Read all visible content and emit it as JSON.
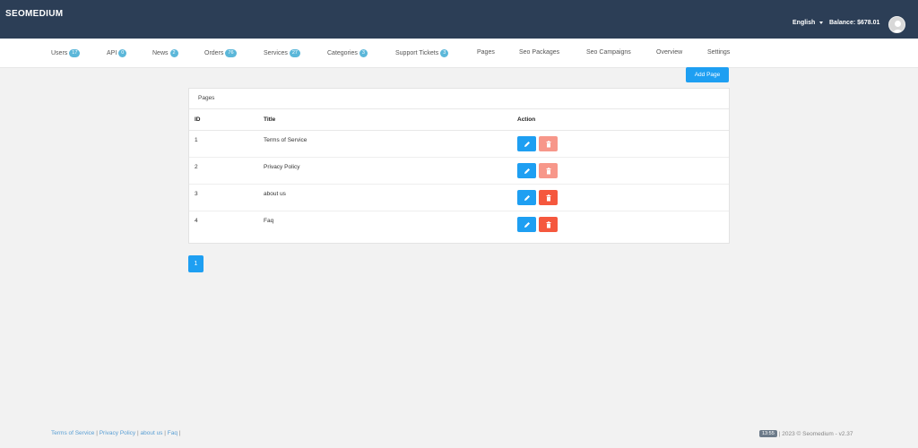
{
  "header": {
    "brand": "SEOMEDIUM",
    "language": "English",
    "balance": "Balance: $678.01"
  },
  "nav": [
    {
      "label": "Users",
      "badge": "17"
    },
    {
      "label": "API",
      "badge": "0"
    },
    {
      "label": "News",
      "badge": "2"
    },
    {
      "label": "Orders",
      "badge": "76"
    },
    {
      "label": "Services",
      "badge": "27"
    },
    {
      "label": "Categories",
      "badge": "3"
    },
    {
      "label": "Support Tickets",
      "badge": "3"
    },
    {
      "label": "Pages"
    },
    {
      "label": "Seo Packages"
    },
    {
      "label": "Seo Campaigns"
    },
    {
      "label": "Overview"
    },
    {
      "label": "Settings"
    }
  ],
  "add_page_label": "Add Page",
  "panel": {
    "title": "Pages",
    "columns": {
      "id": "ID",
      "title": "Title",
      "action": "Action"
    },
    "rows": [
      {
        "id": "1",
        "title": "Terms of Service",
        "delete_color": "#f7978a"
      },
      {
        "id": "2",
        "title": "Privacy Policy",
        "delete_color": "#f7978a"
      },
      {
        "id": "3",
        "title": "about us",
        "delete_color": "#f5583e"
      },
      {
        "id": "4",
        "title": "Faq",
        "delete_color": "#f5583e"
      }
    ]
  },
  "pagination": {
    "current": "1"
  },
  "footer": {
    "links": [
      "Terms of Service",
      "Privacy Policy",
      "about us",
      "Faq"
    ],
    "time": "13:55",
    "copyright": "| 2023 © Seomedium - v2.37"
  },
  "colors": {
    "topbar": "#2c3e56",
    "accent": "#1e9ff2",
    "badge": "#5bb7d9"
  }
}
